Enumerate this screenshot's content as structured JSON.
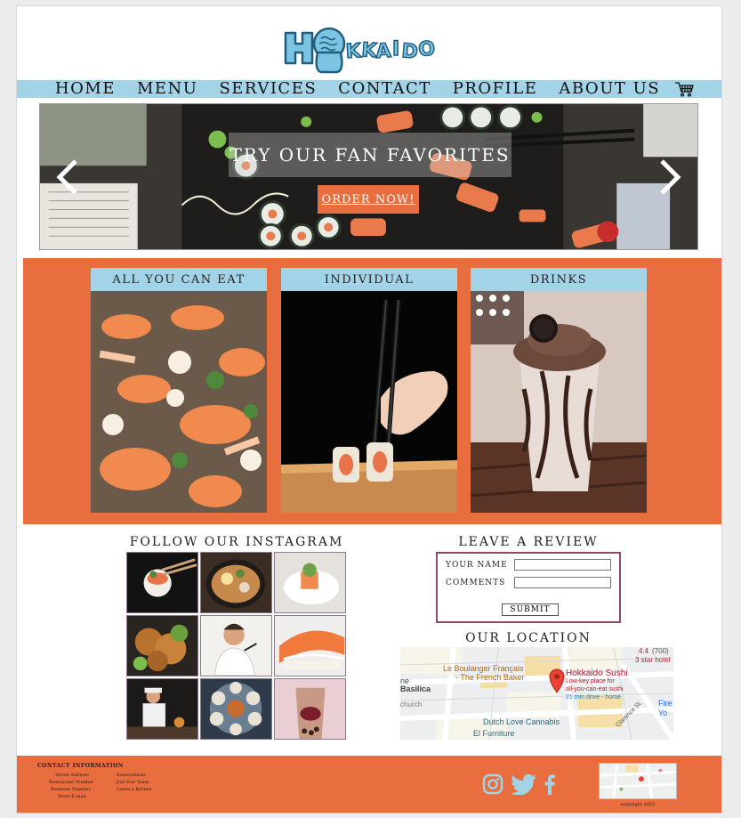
{
  "brand": {
    "logo_text": "HOKKAIDO",
    "primary_color": "#e86d3f",
    "accent_color": "#a3d3e6"
  },
  "nav": {
    "items": [
      "HOME",
      "MENU",
      "SERVICES",
      "CONTACT",
      "PROFILE",
      "ABOUT US"
    ],
    "cart_icon": "shopping-cart-icon"
  },
  "banner": {
    "title": "TRY OUR FAN FAVORITES",
    "cta": "ORDER NOW!",
    "prev_icon": "chevron-left-icon",
    "next_icon": "chevron-right-icon"
  },
  "categories": [
    {
      "title": "ALL YOU CAN EAT"
    },
    {
      "title": "INDIVIDUAL"
    },
    {
      "title": "DRINKS"
    }
  ],
  "instagram": {
    "title": "FOLLOW OUR INSTAGRAM"
  },
  "review": {
    "title": "LEAVE A REVIEW",
    "name_label": "YOUR NAME",
    "comments_label": "COMMENTS",
    "submit": "SUBMIT"
  },
  "location": {
    "title": "OUR LOCATION",
    "map": {
      "rating": "4.4",
      "reviews": "(700)",
      "hotel": "3 star hotel",
      "place_1": "Le Boulanger Français",
      "place_1b": "- The French Baker",
      "restaurant": "Hokkaido Sushi",
      "restaurant_desc_1": "Low-key place for",
      "restaurant_desc_2": "all-you-can-eat sushi",
      "drive": "21 min drive - home",
      "basilica_1": "ne",
      "basilica_2": "Basilica",
      "church": "church",
      "cannabis": "Dutch Love Cannabis",
      "furniture": "El Furniture",
      "street": "Clarence St.",
      "fire_1": "Fire",
      "fire_2": "Yo"
    }
  },
  "footer": {
    "contact_title": "CONTACT INFORMATION",
    "left_links": [
      "Street Address",
      "Restaurant Number",
      "Business Number",
      "Store E-mail"
    ],
    "right_links": [
      "Reservations",
      "Join Our Team",
      "Leave a Review"
    ],
    "social": [
      "instagram-icon",
      "twitter-icon",
      "facebook-icon"
    ],
    "copyright": "copyright 2022"
  }
}
